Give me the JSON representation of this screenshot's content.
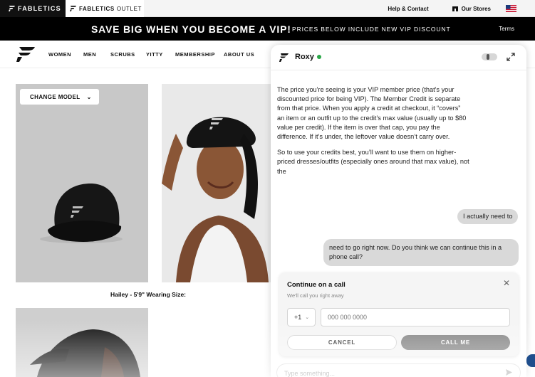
{
  "topbar": {
    "brand_tab": "FABLETICS",
    "outlet_tab_brand": "FABLETICS",
    "outlet_tab_suffix": "OUTLET",
    "help_link": "Help & Contact",
    "stores_link": "Our Stores",
    "flag_icon": "us-flag-icon"
  },
  "vip_banner": {
    "headline": "SAVE BIG WHEN YOU BECOME A VIP!",
    "subtext": "PRICES BELOW INCLUDE NEW VIP DISCOUNT",
    "terms": "Terms"
  },
  "nav": {
    "logo_icon": "fabletics-logo-icon",
    "items": [
      "WOMEN",
      "MEN",
      "SCRUBS",
      "YITTY",
      "MEMBERSHIP",
      "ABOUT US"
    ]
  },
  "product": {
    "change_model_label": "CHANGE MODEL",
    "wearing_caption": "Hailey - 5'9\" Wearing Size:"
  },
  "chat": {
    "agent_name": "Roxy",
    "agent_message_p1": "The price you're seeing is your VIP member price (that's your discounted price for being VIP). The Member Credit is separate from that price. When you apply a credit at checkout, it “covers” an item or an outfit up to the credit’s max value (usually up to $80 value per credit). If the item is over that cap, you pay the difference. If it’s under, the leftover value doesn’t carry over.",
    "agent_message_p2": "So to use your credits best, you’ll want to use them on higher-priced dresses/outfits (especially ones around that max value), not the",
    "user_message_1": "I actually need to",
    "user_message_2": "need to go right now. Do you think we can continue this in a phone call?",
    "call_card": {
      "title": "Continue on a call",
      "subtitle": "We'll call you right away",
      "country_code": "+1",
      "phone_placeholder": "000 000 0000",
      "cancel_label": "CANCEL",
      "call_label": "CALL ME"
    },
    "compose_placeholder": "Type something..."
  },
  "colors": {
    "banner_bg": "#000000",
    "online_dot": "#2aa748",
    "call_button": "#878787"
  }
}
